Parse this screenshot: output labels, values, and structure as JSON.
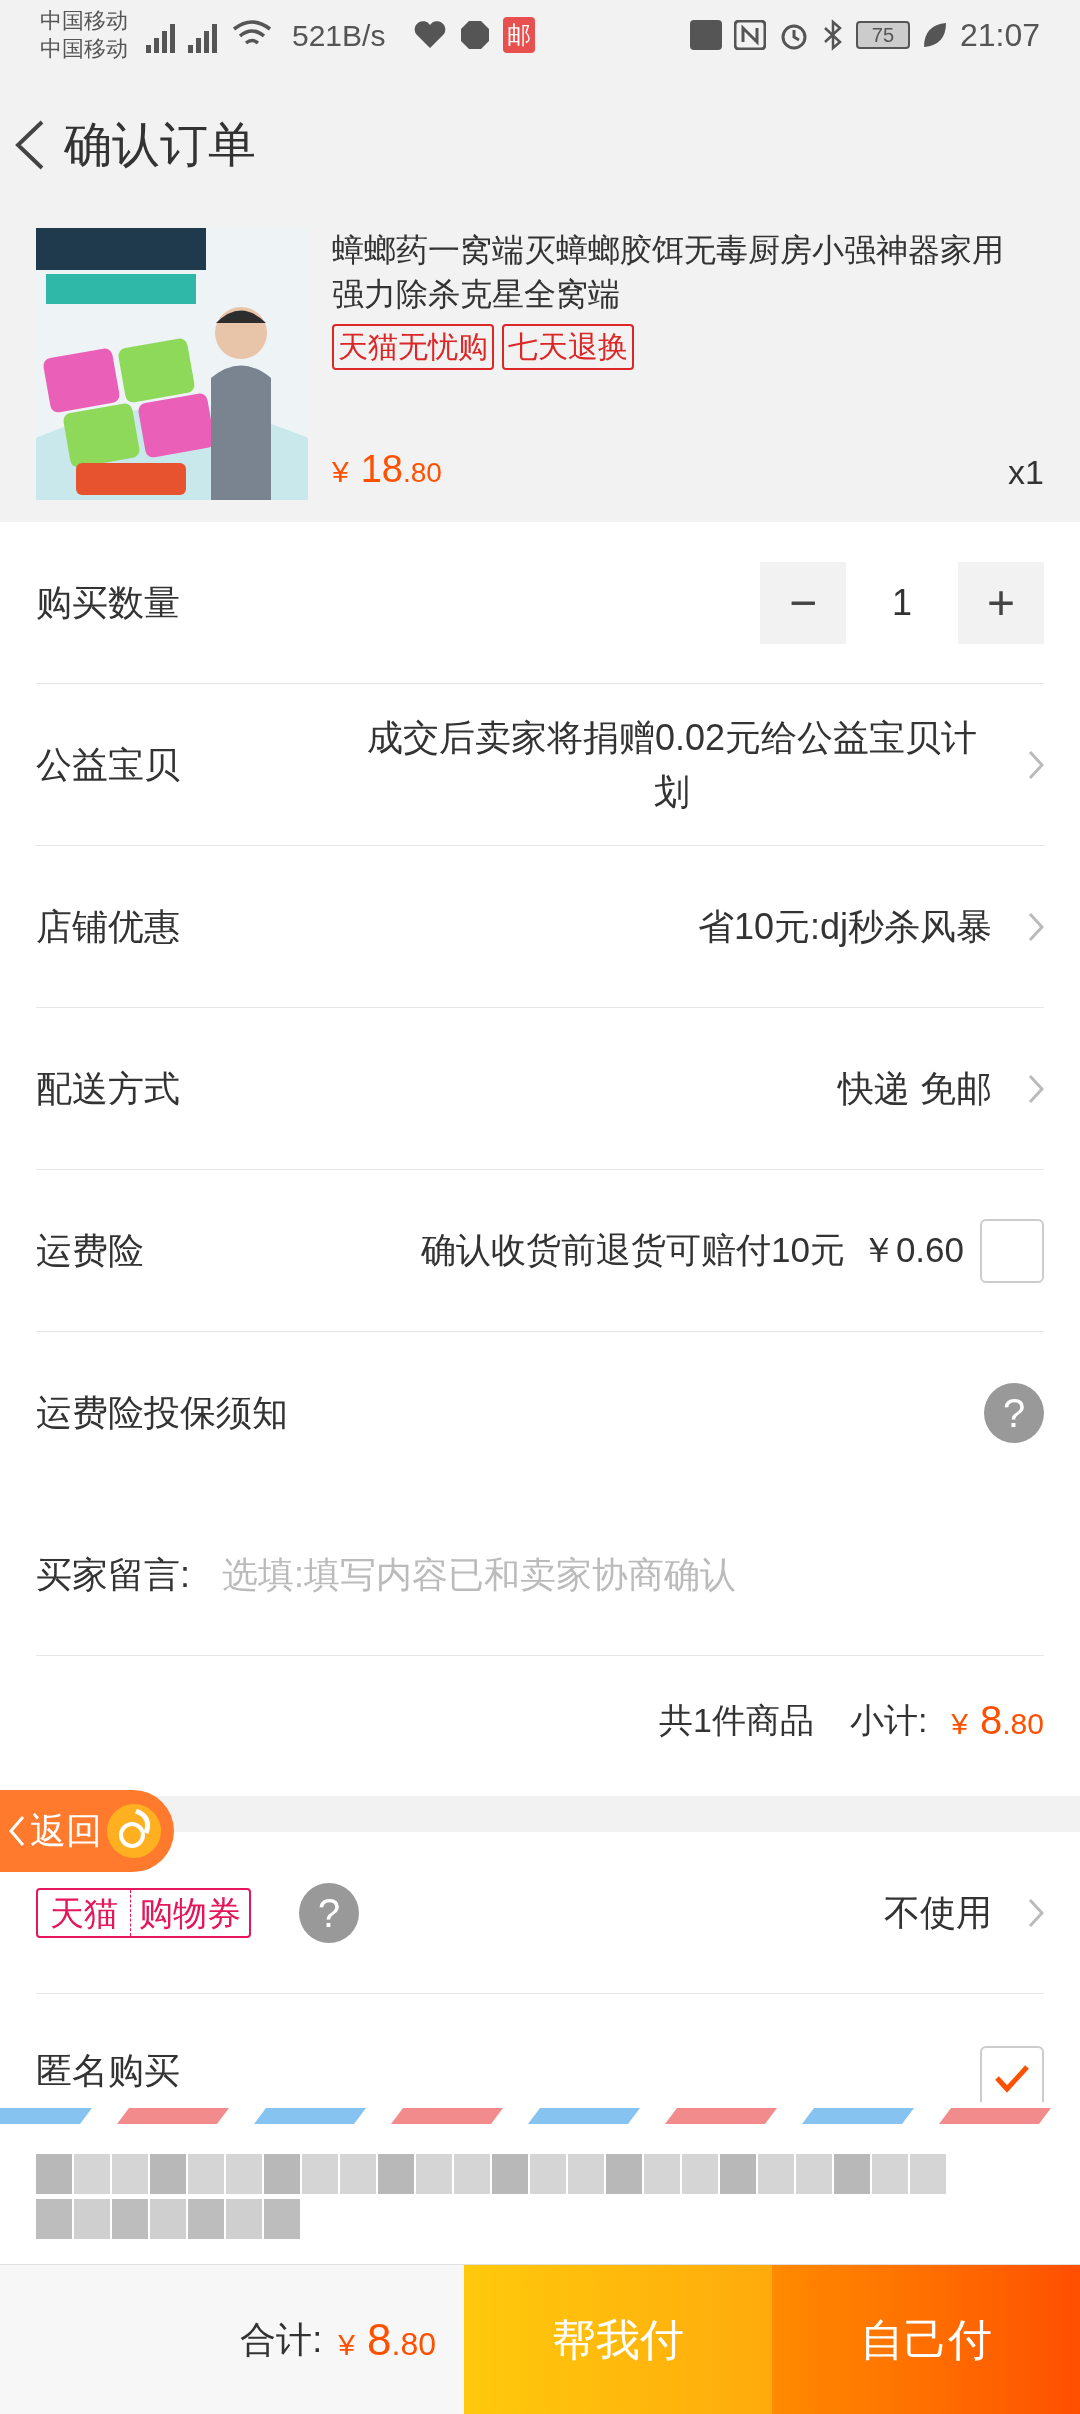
{
  "status_bar": {
    "carriers": [
      "中国移动",
      "中国移动"
    ],
    "network_speed": "521B/s",
    "mail_badge": "邮",
    "battery": "75",
    "time": "21:07"
  },
  "header": {
    "title": "确认订单"
  },
  "product": {
    "title": "蟑螂药一窝端灭蟑螂胶饵无毒厨房小强神器家用强力除杀克星全窝端",
    "tags": [
      "天猫无忧购",
      "七天退换"
    ],
    "price": {
      "symbol": "¥",
      "integer": "18",
      "decimal": ".80"
    },
    "quantity": "x1"
  },
  "rows": [
    {
      "kind": "stepper",
      "label": "购买数量",
      "minus": "−",
      "value": "1",
      "plus": "+"
    },
    {
      "kind": "link",
      "label": "公益宝贝",
      "value": "成交后卖家将捐赠0.02元给公益宝贝计划"
    },
    {
      "kind": "link",
      "label": "店铺优惠",
      "value": "省10元:dj秒杀风暴"
    },
    {
      "kind": "link",
      "label": "配送方式",
      "value": "快递 免邮"
    },
    {
      "kind": "check",
      "label": "运费险",
      "value": "确认收货前退货可赔付10元",
      "price": "￥0.60",
      "checked": false
    },
    {
      "kind": "help",
      "label": "运费险投保须知",
      "icon_text": "?"
    },
    {
      "kind": "input",
      "label": "买家留言:",
      "placeholder": "选填:填写内容已和卖家协商确认"
    }
  ],
  "summary": {
    "count": "共1件商品",
    "subtotal_label": "小计:",
    "price": {
      "symbol": "¥",
      "integer": "8",
      "decimal": ".80"
    }
  },
  "coupon": {
    "brand": "天猫",
    "name": "购物券",
    "icon_text": "?",
    "value": "不使用"
  },
  "anonymous": {
    "label": "匿名购买",
    "checked": true
  },
  "float_back": {
    "label": "返回"
  },
  "footer": {
    "total_label": "合计:",
    "price": {
      "symbol": "¥",
      "integer": "8",
      "decimal": ".80"
    },
    "buttons": [
      "帮我付",
      "自己付"
    ]
  }
}
